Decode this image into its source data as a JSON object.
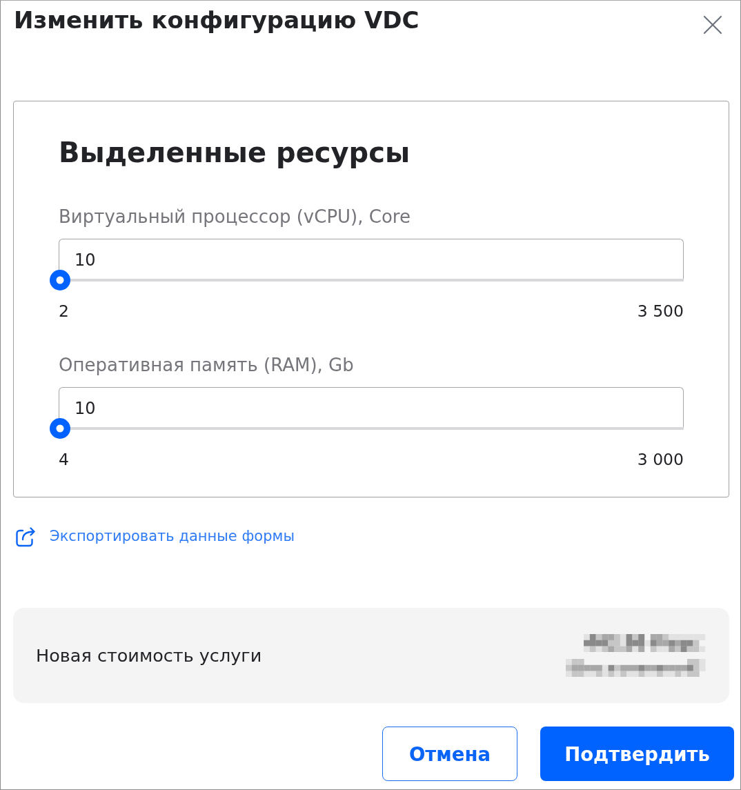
{
  "dialog": {
    "title": "Изменить конфигурацию VDC"
  },
  "resources": {
    "title": "Выделенные ресурсы",
    "sliders": [
      {
        "label": "Виртуальный процессор (vCPU), Core",
        "value": "10",
        "level": 0.002,
        "min": "2",
        "max": "3 500"
      },
      {
        "label": "Оперативная память (RAM), Gb",
        "value": "10",
        "level": 0.002,
        "min": "4",
        "max": "3 000"
      }
    ]
  },
  "export_link": {
    "label": "Экспортировать данные формы"
  },
  "price": {
    "label": "Новая стоимость услуги"
  },
  "buttons": [
    {
      "label": "Отмена",
      "kind": "secondary"
    },
    {
      "label": "Подтвердить",
      "kind": "primary"
    }
  ]
}
